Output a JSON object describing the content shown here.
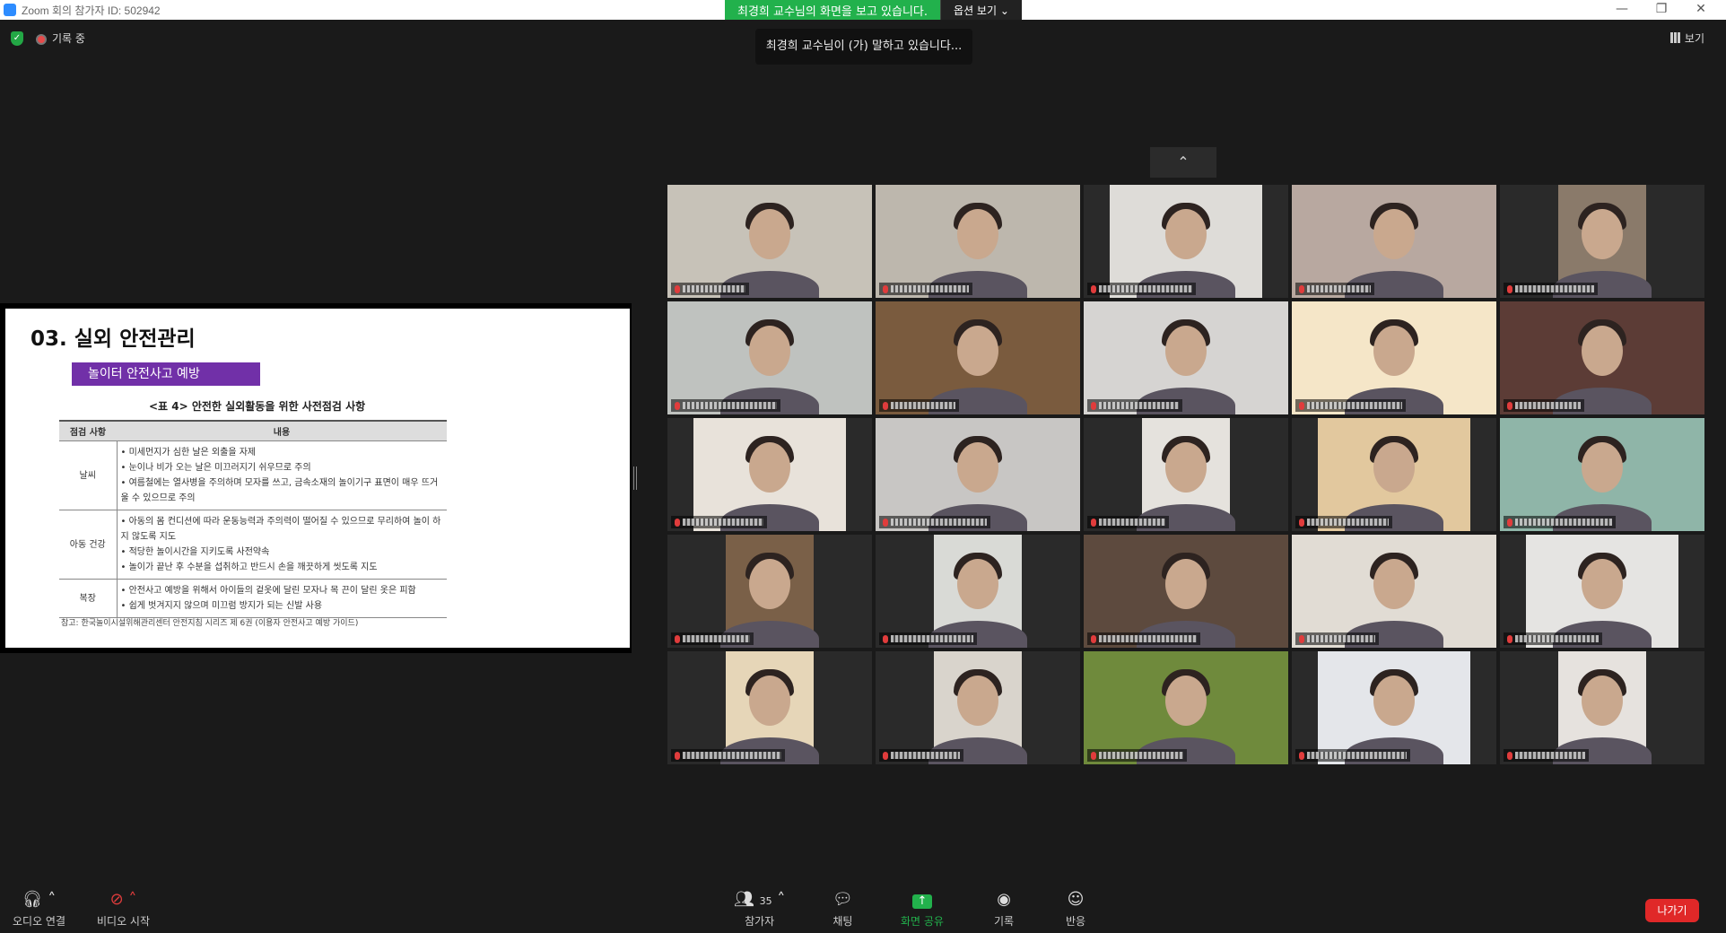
{
  "window": {
    "title": "Zoom 회의 참가자 ID: 502942",
    "minimize": "—",
    "restore": "❐",
    "close": "✕"
  },
  "share_banner": {
    "viewing": "최경희 교수님의 화면을 보고 있습니다.",
    "options": "옵션 보기 ⌄"
  },
  "status": {
    "recording": "기록 중",
    "speaking": "최경희 교수님이 (가) 말하고 있습니다..."
  },
  "view_button": "보기",
  "scroll_up": "⌃",
  "slide": {
    "heading": "03. 실외 안전관리",
    "tag": "놀이터 안전사고 예방",
    "caption": "<표 4> 안전한 실외활동을 위한 사전점검 사항",
    "columns": [
      "점검 사항",
      "내용"
    ],
    "rows": [
      {
        "category": "날씨",
        "items": "• 미세먼지가 심한 날은 외출을 자제\n• 눈이나 비가 오는 날은 미끄러지기 쉬우므로 주의\n• 여름철에는 열사병을 주의하며 모자를 쓰고, 금속소재의 놀이기구 표면이 매우 뜨거울 수 있으므로 주의"
      },
      {
        "category": "아동 건강",
        "items": "• 아동의 몸 컨디션에 따라 운동능력과 주의력이 떨어질 수 있으므로 무리하여 놀이 하지 않도록 지도\n• 적당한 놀이시간을 지키도록 사전약속\n• 놀이가 끝난 후 수분을 섭취하고 반드시 손을 깨끗하게 씻도록 지도"
      },
      {
        "category": "복장",
        "items": "• 안전사고 예방을 위해서 아이들의 겉옷에 달린 모자나 목 끈이 달린 옷은 피함\n• 쉽게 벗겨지지 않으며 미끄럼 방지가 되는 신발 사용"
      }
    ],
    "note": "참고: 한국놀이시설위해관리센터 안전지침 시리즈 제 6권 (이용자 안전사고 예방 가이드)"
  },
  "toolbar": {
    "audio": "오디오 연결",
    "video": "비디오 시작",
    "participants": "참가자",
    "participant_count": "35",
    "chat": "채팅",
    "share": "화면 공유",
    "record": "기록",
    "reactions": "반응",
    "leave": "나가기"
  },
  "colors": {
    "accent_green": "#22b14c",
    "slide_tag": "#7130a8",
    "leave_red": "#e02828"
  }
}
